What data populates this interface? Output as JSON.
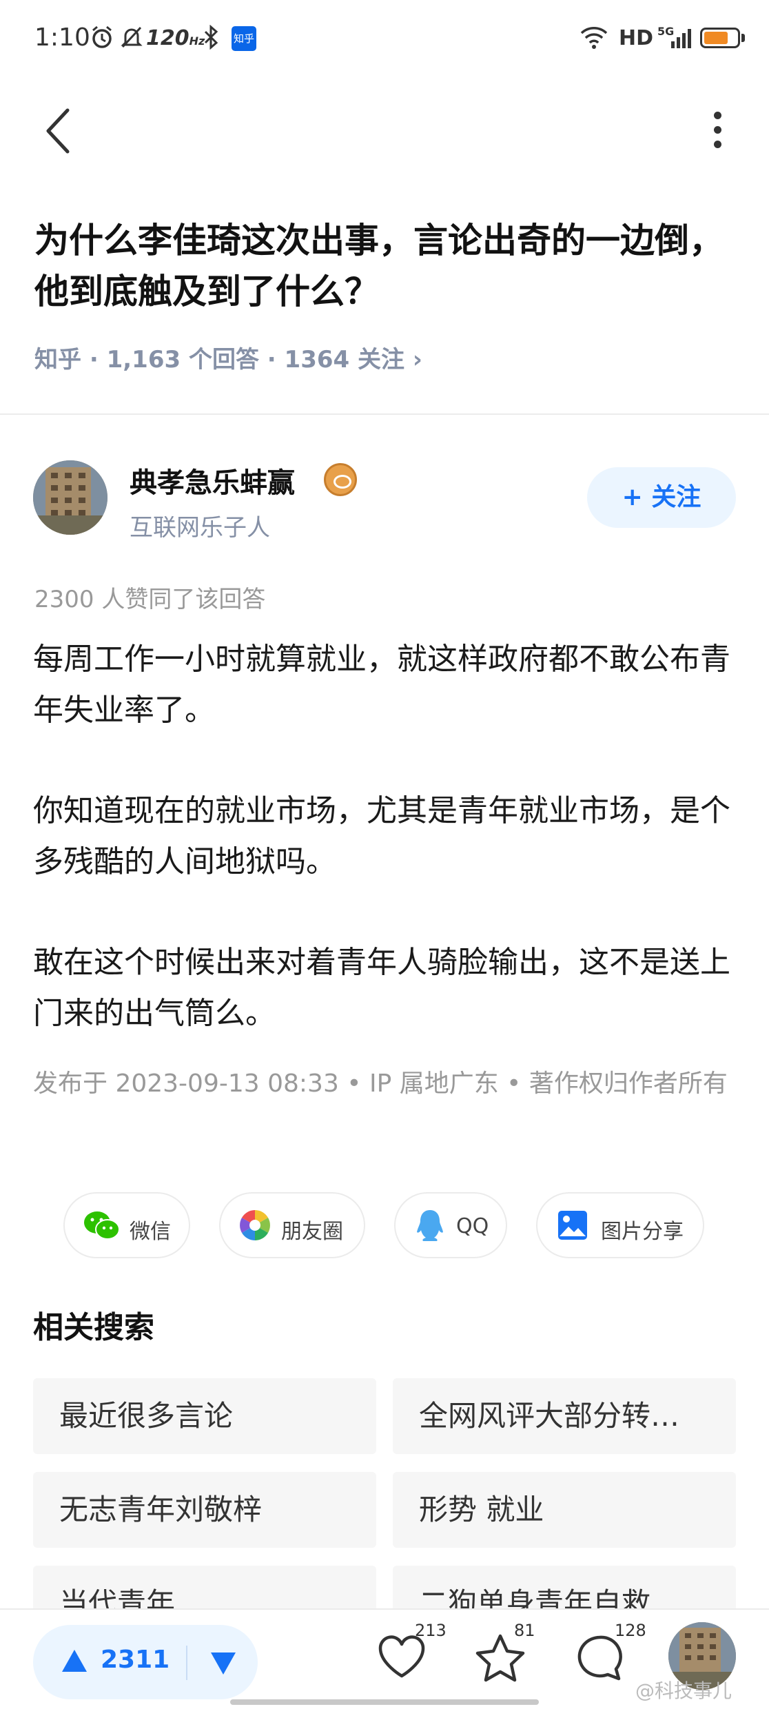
{
  "status_bar": {
    "time": "1:10",
    "refresh_rate": "120",
    "refresh_unit": "Hz",
    "app_badge": "知乎",
    "network": "HD",
    "network_gen": "5G",
    "battery_color": "#f08a24"
  },
  "nav": {
    "back_icon": "chevron-left-icon",
    "more_icon": "more-vertical-icon"
  },
  "question": {
    "title": "为什么李佳琦这次出事，言论出奇的一边倒，他到底触及到了什么？",
    "meta": "知乎 · 1,163 个回答 · 1364 关注 ›"
  },
  "author": {
    "name": "典孝急乐蚌赢",
    "bio": "互联网乐子人",
    "follow_label": "+ 关注"
  },
  "answer": {
    "agree_line": "2300 人赞同了该回答",
    "paragraphs": [
      "每周工作一小时就算就业，就这样政府都不敢公布青年失业率了。",
      "你知道现在的就业市场，尤其是青年就业市场，是个多残酷的人间地狱吗。",
      "敢在这个时候出来对着青年人骑脸输出，这不是送上门来的出气筒么。"
    ],
    "publish_info": "发布于 2023-09-13 08:33 • IP 属地广东 • 著作权归作者所有"
  },
  "share": {
    "wechat": "微信",
    "moments": "朋友圈",
    "qq": "QQ",
    "image": "图片分享"
  },
  "related": {
    "title": "相关搜索",
    "items": [
      "最近很多言论",
      "全网风评大部分转…",
      "无志青年刘敬梓",
      "形势 就业",
      "当代青年",
      "二狗单身青年自救…"
    ]
  },
  "bottom_bar": {
    "upvote_count": "2311",
    "like_count": "213",
    "favorite_count": "81",
    "comment_count": "128"
  },
  "watermark": "@科技事儿",
  "colors": {
    "brand_blue": "#1772f6",
    "meta_gray": "#8590a6",
    "pill_bg": "#ebf5ff"
  }
}
